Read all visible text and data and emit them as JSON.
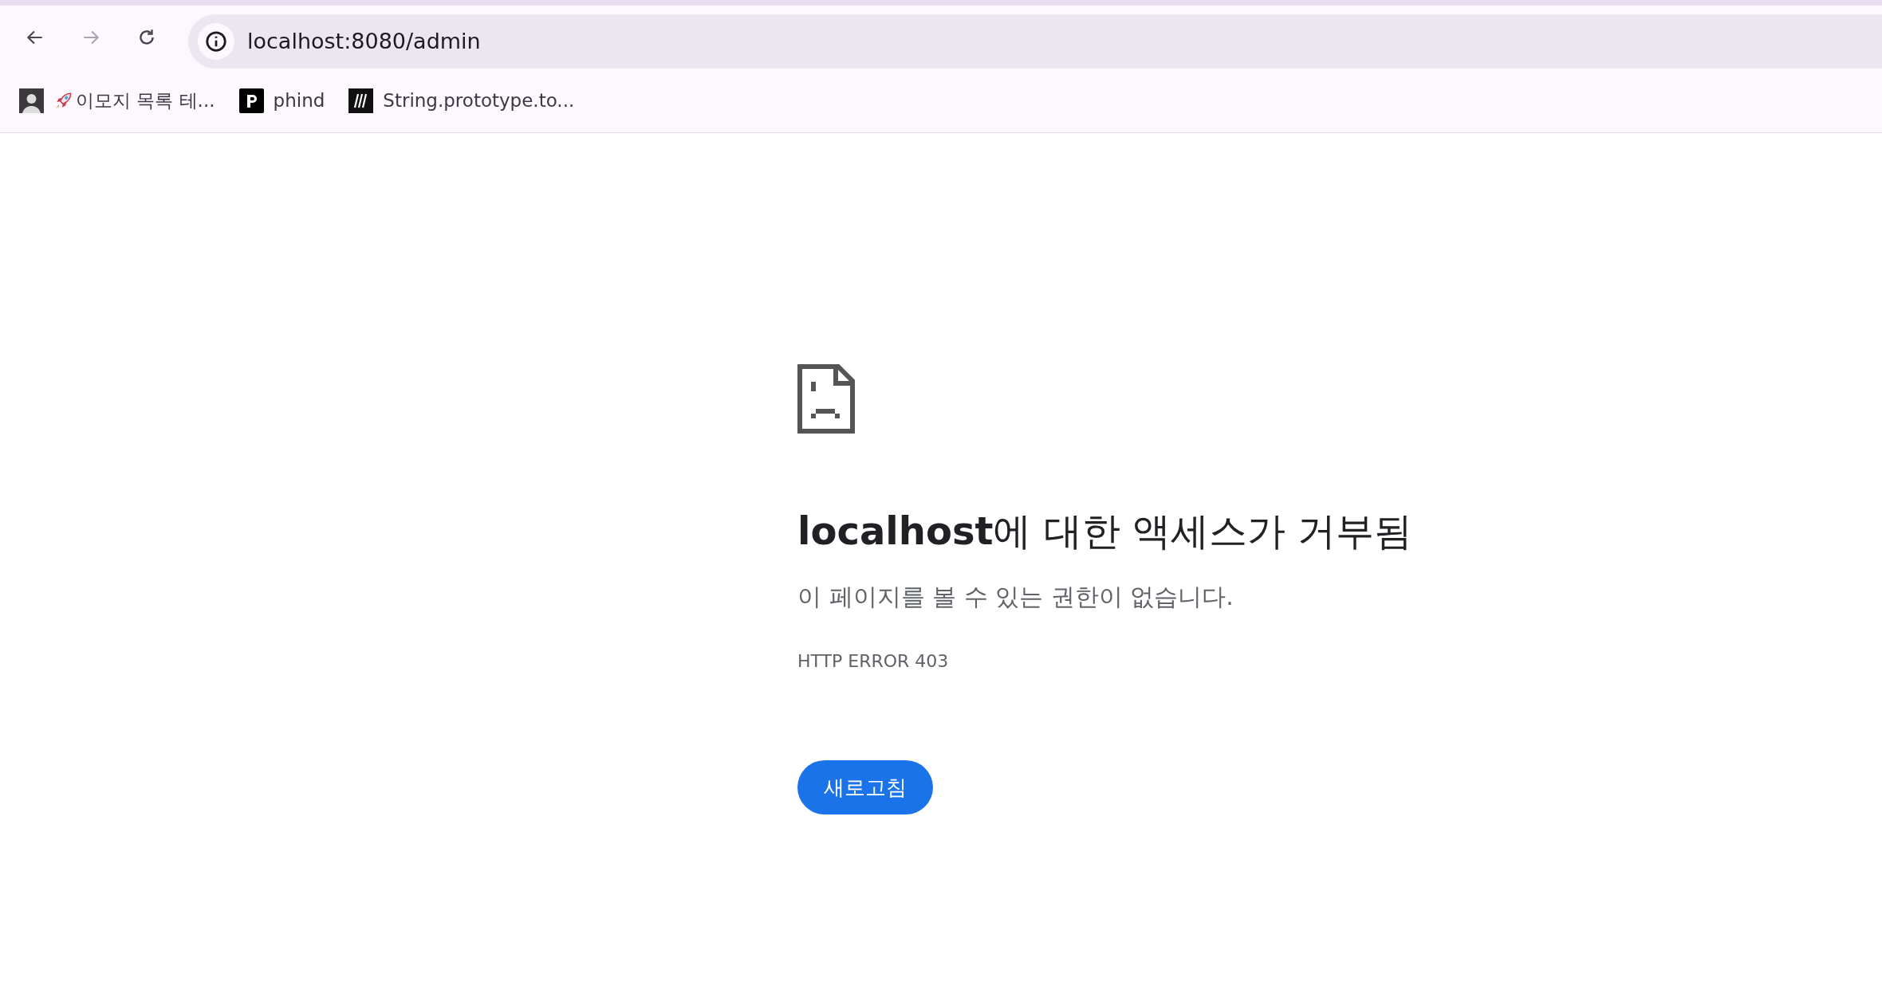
{
  "toolbar": {
    "address": "localhost:8080/admin",
    "back_disabled": false,
    "forward_disabled": true
  },
  "bookmarks": [
    {
      "kind": "avatar",
      "label": "이모지 목록 테...",
      "rocket": true
    },
    {
      "kind": "p",
      "label": "phind",
      "rocket": false
    },
    {
      "kind": "m",
      "label": "String.prototype.to...",
      "rocket": false
    }
  ],
  "error": {
    "heading": "**localhost**에 대한 액세스가 거부됨",
    "message": "이 페이지를 볼 수 있는 권한이 없습니다.",
    "code": "HTTP ERROR 403",
    "button": "새로고침"
  }
}
